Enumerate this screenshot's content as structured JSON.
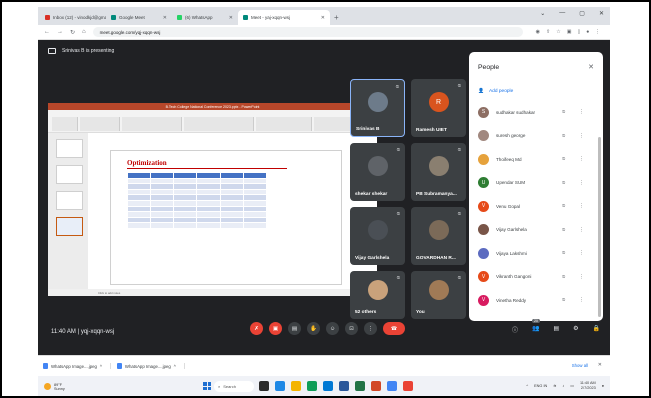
{
  "browser": {
    "tabs": [
      {
        "label": "Inbox (12) - vinodkjd@gmail.co",
        "color": "#d93025",
        "active": false
      },
      {
        "label": "Google Meet",
        "color": "#00897b",
        "active": false
      },
      {
        "label": "(6) WhatsApp",
        "color": "#25d366",
        "active": false
      },
      {
        "label": "Meet - yaj-xqqn-wsj",
        "color": "#00897b",
        "active": true
      }
    ],
    "url": "meet.google.com/yqj-xqqn-wsj"
  },
  "meeting": {
    "presenting_label": "Srinivas B is presenting",
    "time": "11:40 AM",
    "code": "yqj-xqqn-wsj",
    "participant_count": "20"
  },
  "slide": {
    "title": "Optimization",
    "window_title": "B.Tech College National Conference 2023.pptx - PowerPoint",
    "notes_hint": "Click to add notes"
  },
  "tiles": [
    {
      "name": "Srinivas B",
      "avatar_color": "#6d7b8a",
      "highlight": true
    },
    {
      "name": "Ramesh UIET",
      "initial": "R",
      "avatar_color": "#d9541e",
      "highlight": false
    },
    {
      "name": "shekar shekar",
      "avatar_color": "#5f6368",
      "highlight": false
    },
    {
      "name": "PB Subramanya...",
      "avatar_color": "#8a7f70",
      "highlight": false
    },
    {
      "name": "Vijay Garlshela",
      "avatar_color": "#4a4f55",
      "highlight": false
    },
    {
      "name": "GOVARDHAN R...",
      "avatar_color": "#7b6a58",
      "highlight": false
    },
    {
      "name": "52 others",
      "avatar_color": "#c9a27b",
      "highlight": false
    },
    {
      "name": "You",
      "avatar_color": "#a07a56",
      "highlight": false
    }
  ],
  "people_panel": {
    "title": "People",
    "add_label": "Add people",
    "people": [
      {
        "name": "sudhakar sudhakar",
        "initial": "S",
        "color": "#8d6e63"
      },
      {
        "name": "suresh george",
        "initial": "",
        "color": "#a1887f"
      },
      {
        "name": "Thoifeeq Md",
        "initial": "",
        "color": "#e6a23c"
      },
      {
        "name": "Upendar SUM",
        "initial": "U",
        "color": "#2e7d32"
      },
      {
        "name": "Venu Gopal",
        "initial": "V",
        "color": "#e64a19"
      },
      {
        "name": "Vijay Garlshela",
        "initial": "",
        "color": "#795548"
      },
      {
        "name": "Vijaya Lakshmi",
        "initial": "",
        "color": "#5c6bc0"
      },
      {
        "name": "Vikranth Gangoni",
        "initial": "V",
        "color": "#e64a19"
      },
      {
        "name": "Vinetha Reddy",
        "initial": "V",
        "color": "#d81b60"
      }
    ]
  },
  "downloads": {
    "items": [
      "WhatsApp Image....jpeg",
      "WhatsApp Image....jpeg"
    ],
    "show_all": "Show all"
  },
  "taskbar": {
    "weather_temp": "89°F",
    "weather_text": "Sunny",
    "search": "Search",
    "lang": "ENG",
    "region": "IN",
    "clock_time": "11:40 AM",
    "clock_date": "2/7/2023"
  }
}
